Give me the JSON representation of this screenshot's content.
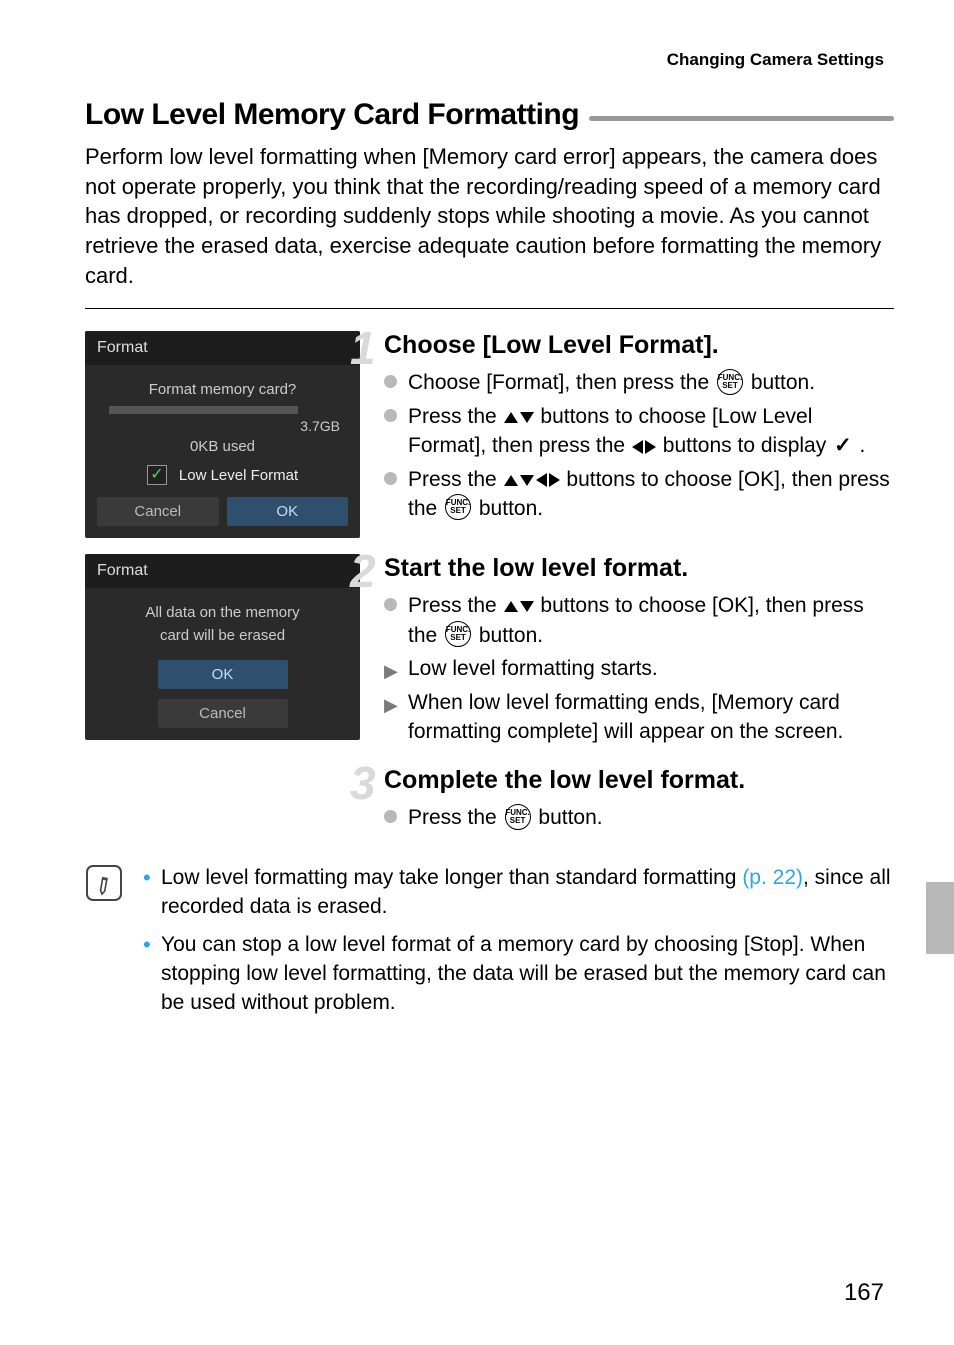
{
  "header": {
    "breadcrumb": "Changing Camera Settings"
  },
  "section": {
    "title": "Low Level Memory Card Formatting",
    "intro": "Perform low level formatting when [Memory card error] appears, the camera does not operate properly, you think that the recording/reading speed of a memory card has dropped, or recording suddenly stops while shooting a movie. As you cannot retrieve the erased data, exercise adequate caution before formatting the memory card."
  },
  "screen1": {
    "title": "Format",
    "line1": "Format memory card?",
    "capacity": "3.7GB",
    "used": "0KB used",
    "option": "Low Level Format",
    "btn_cancel": "Cancel",
    "btn_ok": "OK"
  },
  "screen2": {
    "title": "Format",
    "line1": "All data on the memory",
    "line2": "card will be erased",
    "btn_ok": "OK",
    "btn_cancel": "Cancel"
  },
  "steps": [
    {
      "num": "1",
      "title": "Choose [Low Level Format].",
      "items": [
        {
          "type": "dot",
          "pre": "Choose [Format], then press the ",
          "icon": "func",
          "post": " button."
        },
        {
          "type": "dot",
          "pre": "Press the ",
          "icon": "updown",
          "mid": " buttons to choose [Low Level Format], then press the ",
          "icon2": "leftright",
          "mid2": " buttons to display ",
          "icon3": "check",
          "post": "."
        },
        {
          "type": "dot",
          "pre": "Press the ",
          "icon": "all",
          "mid": " buttons to choose [OK], then press the ",
          "icon2": "func",
          "post": " button."
        }
      ]
    },
    {
      "num": "2",
      "title": "Start the low level format.",
      "items": [
        {
          "type": "dot",
          "pre": "Press the ",
          "icon": "updown",
          "mid": " buttons to choose [OK], then press the ",
          "icon2": "func",
          "post": " button."
        },
        {
          "type": "arrow",
          "text": "Low level formatting starts."
        },
        {
          "type": "arrow",
          "text": "When low level formatting ends, [Memory card formatting complete] will appear on the screen."
        }
      ]
    },
    {
      "num": "3",
      "title": "Complete the low level format.",
      "items": [
        {
          "type": "dot",
          "pre": "Press the ",
          "icon": "func",
          "post": " button."
        }
      ]
    }
  ],
  "notes": [
    {
      "pre": "Low level formatting may take longer than standard formatting ",
      "link": "(p. 22)",
      "post": ", since all recorded data is erased."
    },
    {
      "text": "You can stop a low level format of a memory card by choosing [Stop]. When stopping low level formatting, the data will be erased but the memory card can be used without problem."
    }
  ],
  "page_number": "167"
}
